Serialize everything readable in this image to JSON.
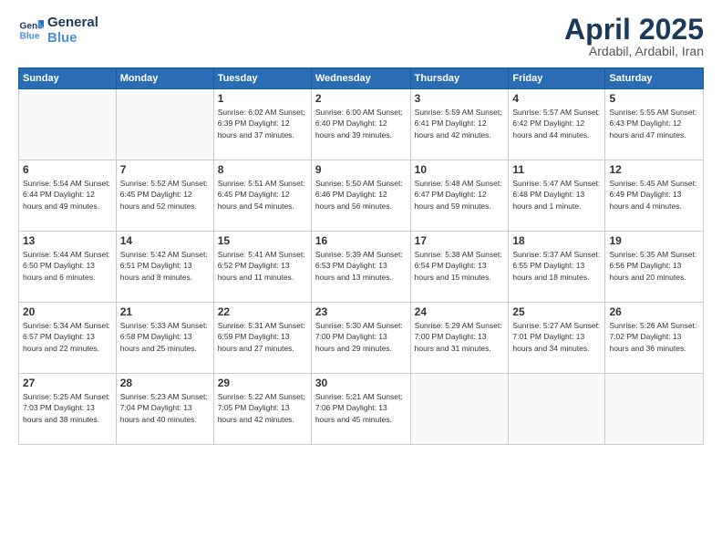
{
  "logo": {
    "line1": "General",
    "line2": "Blue"
  },
  "title": "April 2025",
  "subtitle": "Ardabil, Ardabil, Iran",
  "headers": [
    "Sunday",
    "Monday",
    "Tuesday",
    "Wednesday",
    "Thursday",
    "Friday",
    "Saturday"
  ],
  "weeks": [
    [
      {
        "day": "",
        "info": ""
      },
      {
        "day": "",
        "info": ""
      },
      {
        "day": "1",
        "info": "Sunrise: 6:02 AM\nSunset: 6:39 PM\nDaylight: 12 hours\nand 37 minutes."
      },
      {
        "day": "2",
        "info": "Sunrise: 6:00 AM\nSunset: 6:40 PM\nDaylight: 12 hours\nand 39 minutes."
      },
      {
        "day": "3",
        "info": "Sunrise: 5:59 AM\nSunset: 6:41 PM\nDaylight: 12 hours\nand 42 minutes."
      },
      {
        "day": "4",
        "info": "Sunrise: 5:57 AM\nSunset: 6:42 PM\nDaylight: 12 hours\nand 44 minutes."
      },
      {
        "day": "5",
        "info": "Sunrise: 5:55 AM\nSunset: 6:43 PM\nDaylight: 12 hours\nand 47 minutes."
      }
    ],
    [
      {
        "day": "6",
        "info": "Sunrise: 5:54 AM\nSunset: 6:44 PM\nDaylight: 12 hours\nand 49 minutes."
      },
      {
        "day": "7",
        "info": "Sunrise: 5:52 AM\nSunset: 6:45 PM\nDaylight: 12 hours\nand 52 minutes."
      },
      {
        "day": "8",
        "info": "Sunrise: 5:51 AM\nSunset: 6:45 PM\nDaylight: 12 hours\nand 54 minutes."
      },
      {
        "day": "9",
        "info": "Sunrise: 5:50 AM\nSunset: 6:46 PM\nDaylight: 12 hours\nand 56 minutes."
      },
      {
        "day": "10",
        "info": "Sunrise: 5:48 AM\nSunset: 6:47 PM\nDaylight: 12 hours\nand 59 minutes."
      },
      {
        "day": "11",
        "info": "Sunrise: 5:47 AM\nSunset: 6:48 PM\nDaylight: 13 hours\nand 1 minute."
      },
      {
        "day": "12",
        "info": "Sunrise: 5:45 AM\nSunset: 6:49 PM\nDaylight: 13 hours\nand 4 minutes."
      }
    ],
    [
      {
        "day": "13",
        "info": "Sunrise: 5:44 AM\nSunset: 6:50 PM\nDaylight: 13 hours\nand 6 minutes."
      },
      {
        "day": "14",
        "info": "Sunrise: 5:42 AM\nSunset: 6:51 PM\nDaylight: 13 hours\nand 8 minutes."
      },
      {
        "day": "15",
        "info": "Sunrise: 5:41 AM\nSunset: 6:52 PM\nDaylight: 13 hours\nand 11 minutes."
      },
      {
        "day": "16",
        "info": "Sunrise: 5:39 AM\nSunset: 6:53 PM\nDaylight: 13 hours\nand 13 minutes."
      },
      {
        "day": "17",
        "info": "Sunrise: 5:38 AM\nSunset: 6:54 PM\nDaylight: 13 hours\nand 15 minutes."
      },
      {
        "day": "18",
        "info": "Sunrise: 5:37 AM\nSunset: 6:55 PM\nDaylight: 13 hours\nand 18 minutes."
      },
      {
        "day": "19",
        "info": "Sunrise: 5:35 AM\nSunset: 6:56 PM\nDaylight: 13 hours\nand 20 minutes."
      }
    ],
    [
      {
        "day": "20",
        "info": "Sunrise: 5:34 AM\nSunset: 6:57 PM\nDaylight: 13 hours\nand 22 minutes."
      },
      {
        "day": "21",
        "info": "Sunrise: 5:33 AM\nSunset: 6:58 PM\nDaylight: 13 hours\nand 25 minutes."
      },
      {
        "day": "22",
        "info": "Sunrise: 5:31 AM\nSunset: 6:59 PM\nDaylight: 13 hours\nand 27 minutes."
      },
      {
        "day": "23",
        "info": "Sunrise: 5:30 AM\nSunset: 7:00 PM\nDaylight: 13 hours\nand 29 minutes."
      },
      {
        "day": "24",
        "info": "Sunrise: 5:29 AM\nSunset: 7:00 PM\nDaylight: 13 hours\nand 31 minutes."
      },
      {
        "day": "25",
        "info": "Sunrise: 5:27 AM\nSunset: 7:01 PM\nDaylight: 13 hours\nand 34 minutes."
      },
      {
        "day": "26",
        "info": "Sunrise: 5:26 AM\nSunset: 7:02 PM\nDaylight: 13 hours\nand 36 minutes."
      }
    ],
    [
      {
        "day": "27",
        "info": "Sunrise: 5:25 AM\nSunset: 7:03 PM\nDaylight: 13 hours\nand 38 minutes."
      },
      {
        "day": "28",
        "info": "Sunrise: 5:23 AM\nSunset: 7:04 PM\nDaylight: 13 hours\nand 40 minutes."
      },
      {
        "day": "29",
        "info": "Sunrise: 5:22 AM\nSunset: 7:05 PM\nDaylight: 13 hours\nand 42 minutes."
      },
      {
        "day": "30",
        "info": "Sunrise: 5:21 AM\nSunset: 7:06 PM\nDaylight: 13 hours\nand 45 minutes."
      },
      {
        "day": "",
        "info": ""
      },
      {
        "day": "",
        "info": ""
      },
      {
        "day": "",
        "info": ""
      }
    ]
  ]
}
